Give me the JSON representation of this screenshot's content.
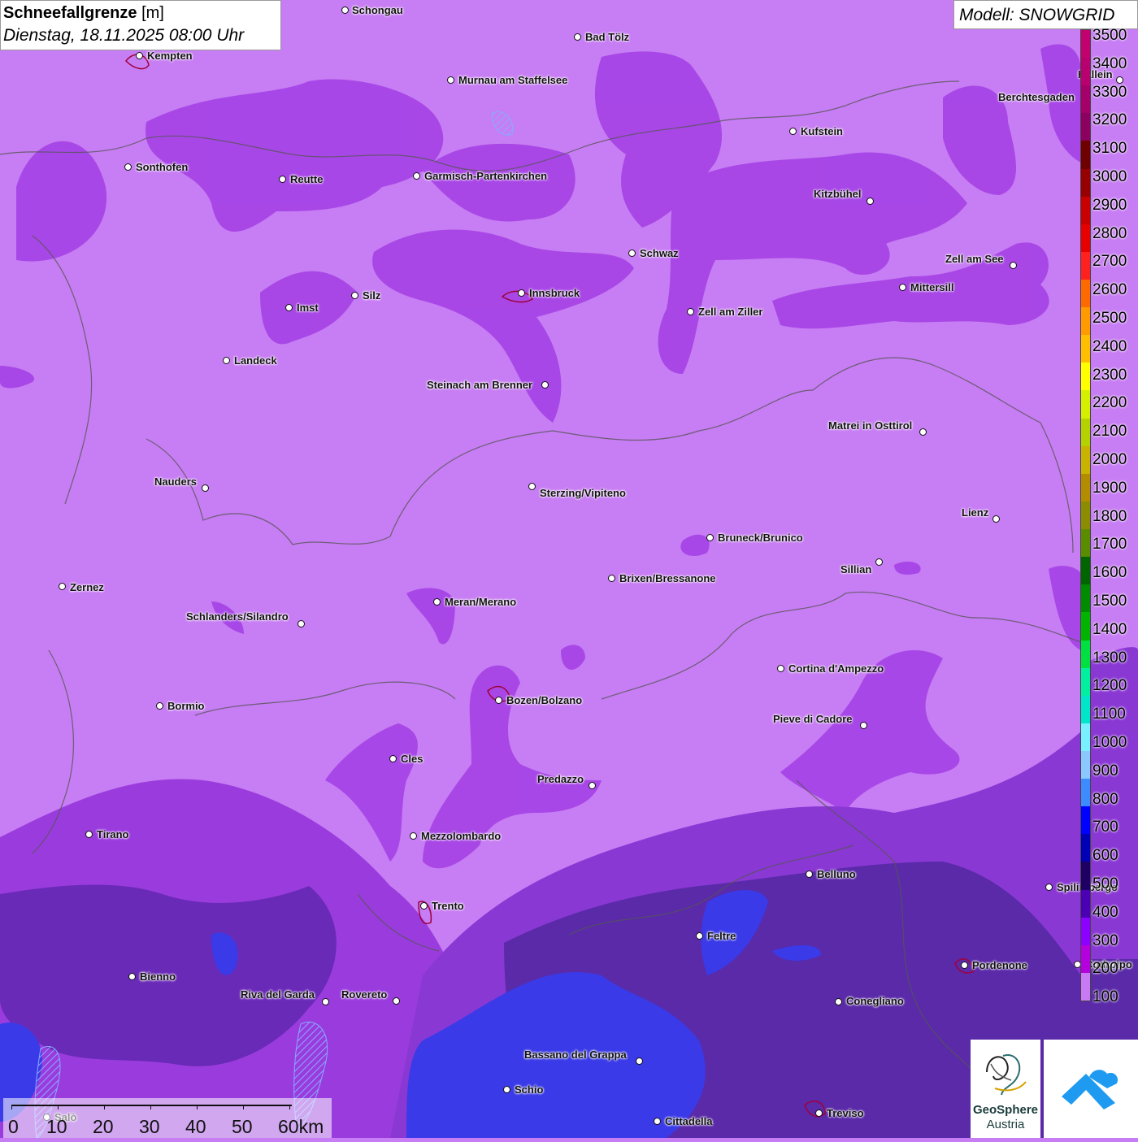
{
  "title": {
    "label": "Schneefallgrenze",
    "unit": "[m]",
    "datetime": "Dienstag, 18.11.2025 08:00 Uhr"
  },
  "model": {
    "label": "Modell: SNOWGRID"
  },
  "legend": {
    "items": [
      {
        "value": "3500",
        "color": "#c2006e"
      },
      {
        "value": "3400",
        "color": "#b8006e"
      },
      {
        "value": "3300",
        "color": "#a5006a"
      },
      {
        "value": "3200",
        "color": "#8c0060"
      },
      {
        "value": "3100",
        "color": "#6e0000"
      },
      {
        "value": "3000",
        "color": "#960000"
      },
      {
        "value": "2900",
        "color": "#c80000"
      },
      {
        "value": "2800",
        "color": "#e60000"
      },
      {
        "value": "2700",
        "color": "#ff2020"
      },
      {
        "value": "2600",
        "color": "#ff6a00"
      },
      {
        "value": "2500",
        "color": "#ff9a00"
      },
      {
        "value": "2400",
        "color": "#ffbf00"
      },
      {
        "value": "2300",
        "color": "#ffff00"
      },
      {
        "value": "2200",
        "color": "#d4f000"
      },
      {
        "value": "2100",
        "color": "#b4d200"
      },
      {
        "value": "2000",
        "color": "#c8b400"
      },
      {
        "value": "1900",
        "color": "#b48c00"
      },
      {
        "value": "1800",
        "color": "#8c8c00"
      },
      {
        "value": "1700",
        "color": "#5a8c00"
      },
      {
        "value": "1600",
        "color": "#006400"
      },
      {
        "value": "1500",
        "color": "#008c00"
      },
      {
        "value": "1400",
        "color": "#00b400"
      },
      {
        "value": "1300",
        "color": "#00e040"
      },
      {
        "value": "1200",
        "color": "#00f0a0"
      },
      {
        "value": "1100",
        "color": "#00e6c8"
      },
      {
        "value": "1000",
        "color": "#78f0ff"
      },
      {
        "value": "900",
        "color": "#8cc8ff"
      },
      {
        "value": "800",
        "color": "#3c8cff"
      },
      {
        "value": "700",
        "color": "#0000ff"
      },
      {
        "value": "600",
        "color": "#0000b4"
      },
      {
        "value": "500",
        "color": "#1e0064"
      },
      {
        "value": "400",
        "color": "#4b00b4"
      },
      {
        "value": "300",
        "color": "#8c00ff"
      },
      {
        "value": "200",
        "color": "#b400dc"
      },
      {
        "value": "100",
        "color": "#c87af5"
      }
    ]
  },
  "cities": [
    {
      "name": "Schongau"
    },
    {
      "name": "Bad Tölz"
    },
    {
      "name": "Kempten"
    },
    {
      "name": "Murnau am Staffelsee"
    },
    {
      "name": "Hallein"
    },
    {
      "name": "Berchtesgaden"
    },
    {
      "name": "Kufstein"
    },
    {
      "name": "Sonthofen"
    },
    {
      "name": "Reutte"
    },
    {
      "name": "Garmisch-Partenkirchen"
    },
    {
      "name": "Kitzbühel"
    },
    {
      "name": "Schwaz"
    },
    {
      "name": "Zell am See"
    },
    {
      "name": "Mittersill"
    },
    {
      "name": "Innsbruck"
    },
    {
      "name": "Imst"
    },
    {
      "name": "Silz"
    },
    {
      "name": "Zell am Ziller"
    },
    {
      "name": "Landeck"
    },
    {
      "name": "Steinach am Brenner"
    },
    {
      "name": "Matrei in Osttirol"
    },
    {
      "name": "Nauders"
    },
    {
      "name": "Sterzing/Vipiteno"
    },
    {
      "name": "Lienz"
    },
    {
      "name": "Bruneck/Brunico"
    },
    {
      "name": "Sillian"
    },
    {
      "name": "Brixen/Bressanone"
    },
    {
      "name": "Zernez"
    },
    {
      "name": "Meran/Merano"
    },
    {
      "name": "Schlanders/Silandro"
    },
    {
      "name": "Cortina d'Ampezzo"
    },
    {
      "name": "Bormio"
    },
    {
      "name": "Bozen/Bolzano"
    },
    {
      "name": "Pieve di Cadore"
    },
    {
      "name": "Cles"
    },
    {
      "name": "Predazzo"
    },
    {
      "name": "Tirano"
    },
    {
      "name": "Mezzolombardo"
    },
    {
      "name": "Belluno"
    },
    {
      "name": "Spilimbergo"
    },
    {
      "name": "Trento"
    },
    {
      "name": "Feltre"
    },
    {
      "name": "Pordenone"
    },
    {
      "name": "Codroipo"
    },
    {
      "name": "Bienno"
    },
    {
      "name": "Riva del Garda"
    },
    {
      "name": "Rovereto"
    },
    {
      "name": "Conegliano"
    },
    {
      "name": "Bassano del Grappa"
    },
    {
      "name": "Schio"
    },
    {
      "name": "Treviso"
    },
    {
      "name": "Cittadella"
    },
    {
      "name": "Salò"
    }
  ],
  "scale": {
    "ticks": [
      "0",
      "10",
      "20",
      "30",
      "40",
      "50",
      "60km"
    ]
  },
  "logo": {
    "line1": "GeoSphere",
    "line2": "Austria"
  }
}
